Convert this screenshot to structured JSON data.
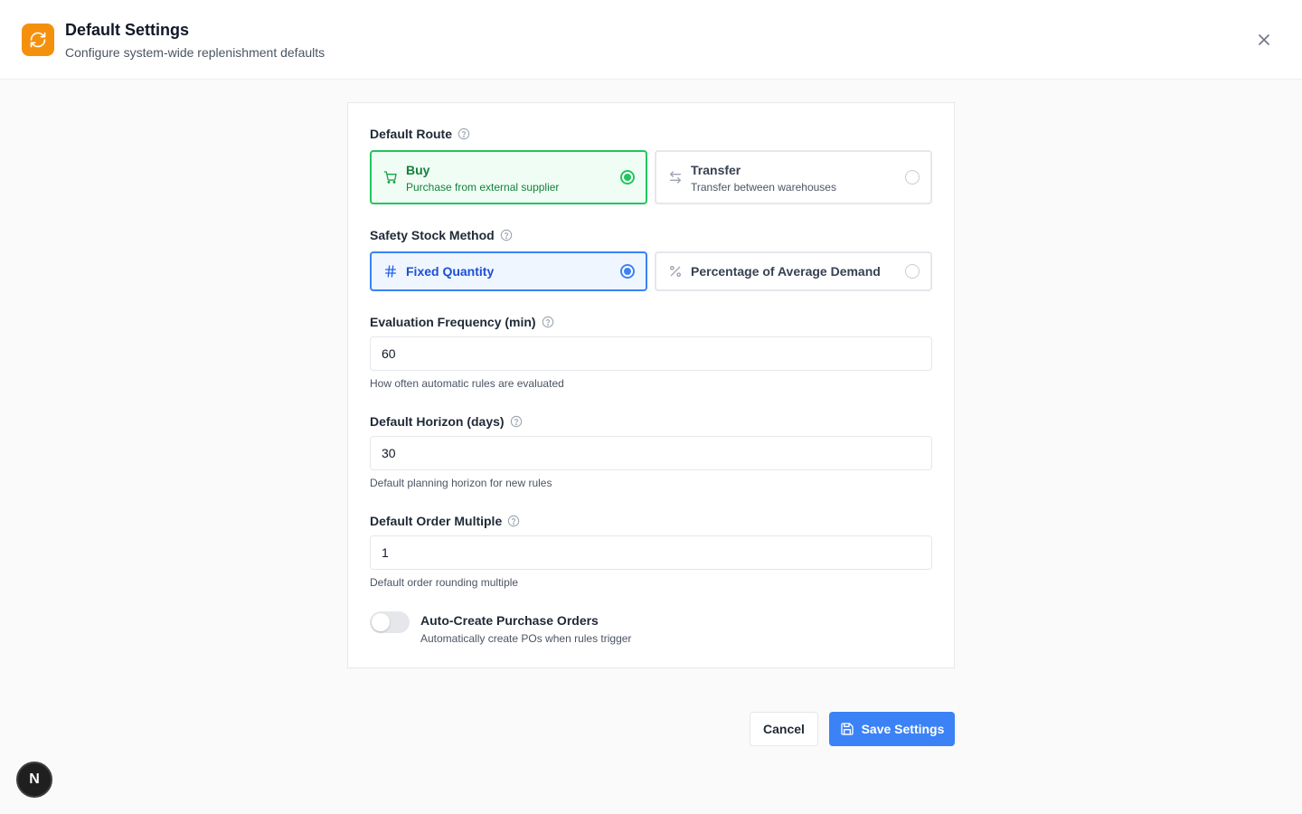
{
  "header": {
    "title": "Default Settings",
    "subtitle": "Configure system-wide replenishment defaults"
  },
  "route": {
    "label": "Default Route",
    "options": [
      {
        "title": "Buy",
        "desc": "Purchase from external supplier",
        "selected": true
      },
      {
        "title": "Transfer",
        "desc": "Transfer between warehouses",
        "selected": false
      }
    ]
  },
  "safety": {
    "label": "Safety Stock Method",
    "options": [
      {
        "title": "Fixed Quantity",
        "selected": true
      },
      {
        "title": "Percentage of Average Demand",
        "selected": false
      }
    ]
  },
  "eval_freq": {
    "label": "Evaluation Frequency (min)",
    "value": "60",
    "hint": "How often automatic rules are evaluated"
  },
  "horizon": {
    "label": "Default Horizon (days)",
    "value": "30",
    "hint": "Default planning horizon for new rules"
  },
  "order_multiple": {
    "label": "Default Order Multiple",
    "value": "1",
    "hint": "Default order rounding multiple"
  },
  "auto_create": {
    "title": "Auto-Create Purchase Orders",
    "desc": "Automatically create POs when rules trigger",
    "enabled": false
  },
  "buttons": {
    "cancel": "Cancel",
    "save": "Save Settings"
  },
  "badge": {
    "letter": "N"
  },
  "colors": {
    "accent_orange": "#f5900c",
    "primary_blue": "#3b82f6",
    "success_green": "#22c55e"
  }
}
